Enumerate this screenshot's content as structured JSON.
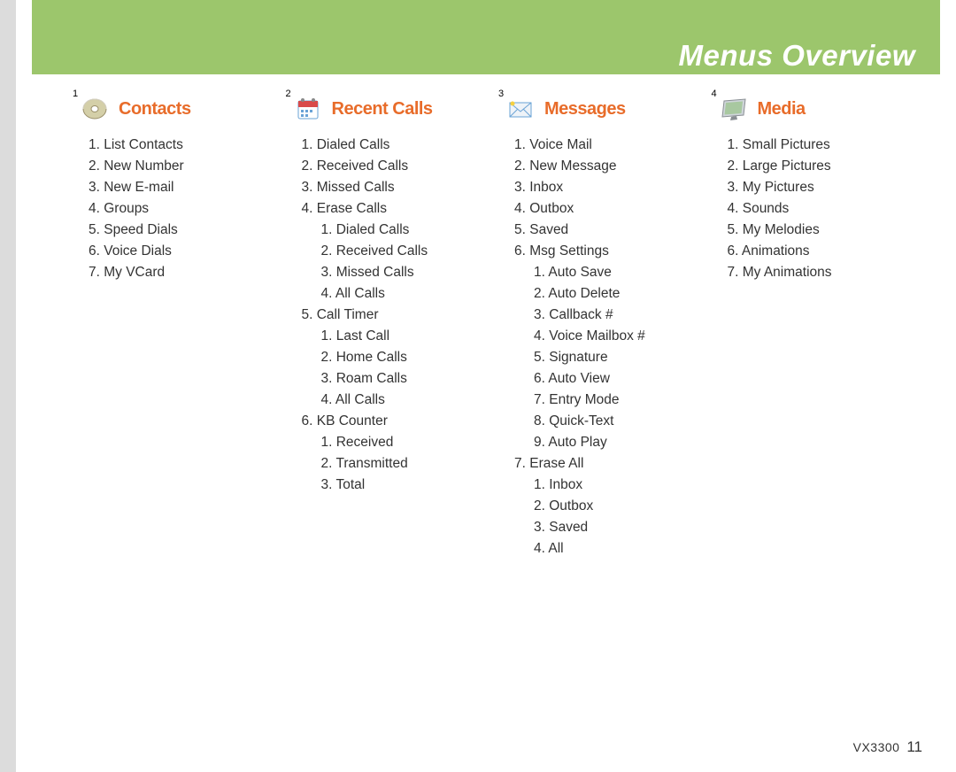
{
  "header": {
    "title": "Menus Overview"
  },
  "footer": {
    "model": "VX3300",
    "page": "11"
  },
  "sections": [
    {
      "badge": "1",
      "title": "Contacts",
      "icon": "contacts-icon",
      "items": [
        {
          "n": "1",
          "t": "List Contacts"
        },
        {
          "n": "2",
          "t": "New Number"
        },
        {
          "n": "3",
          "t": "New E-mail"
        },
        {
          "n": "4",
          "t": "Groups"
        },
        {
          "n": "5",
          "t": "Speed Dials"
        },
        {
          "n": "6",
          "t": "Voice Dials"
        },
        {
          "n": "7",
          "t": "My VCard"
        }
      ]
    },
    {
      "badge": "2",
      "title": "Recent Calls",
      "icon": "calendar-icon",
      "items": [
        {
          "n": "1",
          "t": "Dialed Calls"
        },
        {
          "n": "2",
          "t": "Received Calls"
        },
        {
          "n": "3",
          "t": "Missed Calls"
        },
        {
          "n": "4",
          "t": "Erase Calls",
          "sub": [
            {
              "n": "1",
              "t": "Dialed Calls"
            },
            {
              "n": "2",
              "t": "Received Calls"
            },
            {
              "n": "3",
              "t": "Missed Calls"
            },
            {
              "n": "4",
              "t": "All Calls"
            }
          ]
        },
        {
          "n": "5",
          "t": "Call Timer",
          "sub": [
            {
              "n": "1",
              "t": "Last Call"
            },
            {
              "n": "2",
              "t": "Home Calls"
            },
            {
              "n": "3",
              "t": "Roam Calls"
            },
            {
              "n": "4",
              "t": "All Calls"
            }
          ]
        },
        {
          "n": "6",
          "t": "KB Counter",
          "sub": [
            {
              "n": "1",
              "t": "Received"
            },
            {
              "n": "2",
              "t": "Transmitted"
            },
            {
              "n": "3",
              "t": "Total"
            }
          ]
        }
      ]
    },
    {
      "badge": "3",
      "title": "Messages",
      "icon": "envelope-icon",
      "items": [
        {
          "n": "1",
          "t": "Voice Mail"
        },
        {
          "n": "2",
          "t": "New Message"
        },
        {
          "n": "3",
          "t": "Inbox"
        },
        {
          "n": "4",
          "t": "Outbox"
        },
        {
          "n": "5",
          "t": "Saved"
        },
        {
          "n": "6",
          "t": "Msg Settings",
          "sub": [
            {
              "n": "1",
              "t": "Auto Save"
            },
            {
              "n": "2",
              "t": "Auto Delete"
            },
            {
              "n": "3",
              "t": "Callback #"
            },
            {
              "n": "4",
              "t": "Voice Mailbox #"
            },
            {
              "n": "5",
              "t": "Signature"
            },
            {
              "n": "6",
              "t": "Auto View"
            },
            {
              "n": "7",
              "t": "Entry Mode"
            },
            {
              "n": "8",
              "t": "Quick-Text"
            },
            {
              "n": "9",
              "t": "Auto Play"
            }
          ]
        },
        {
          "n": "7",
          "t": "Erase All",
          "sub": [
            {
              "n": "1",
              "t": "Inbox"
            },
            {
              "n": "2",
              "t": "Outbox"
            },
            {
              "n": "3",
              "t": "Saved"
            },
            {
              "n": "4",
              "t": "All"
            }
          ]
        }
      ]
    },
    {
      "badge": "4",
      "title": "Media",
      "icon": "media-icon",
      "items": [
        {
          "n": "1",
          "t": "Small Pictures"
        },
        {
          "n": "2",
          "t": "Large Pictures"
        },
        {
          "n": "3",
          "t": "My Pictures"
        },
        {
          "n": "4",
          "t": "Sounds"
        },
        {
          "n": "5",
          "t": "My Melodies"
        },
        {
          "n": "6",
          "t": "Animations"
        },
        {
          "n": "7",
          "t": "My Animations"
        }
      ]
    }
  ],
  "icons": {
    "contacts-icon": "disc",
    "calendar-icon": "calendar",
    "envelope-icon": "envelope",
    "media-icon": "monitor"
  }
}
